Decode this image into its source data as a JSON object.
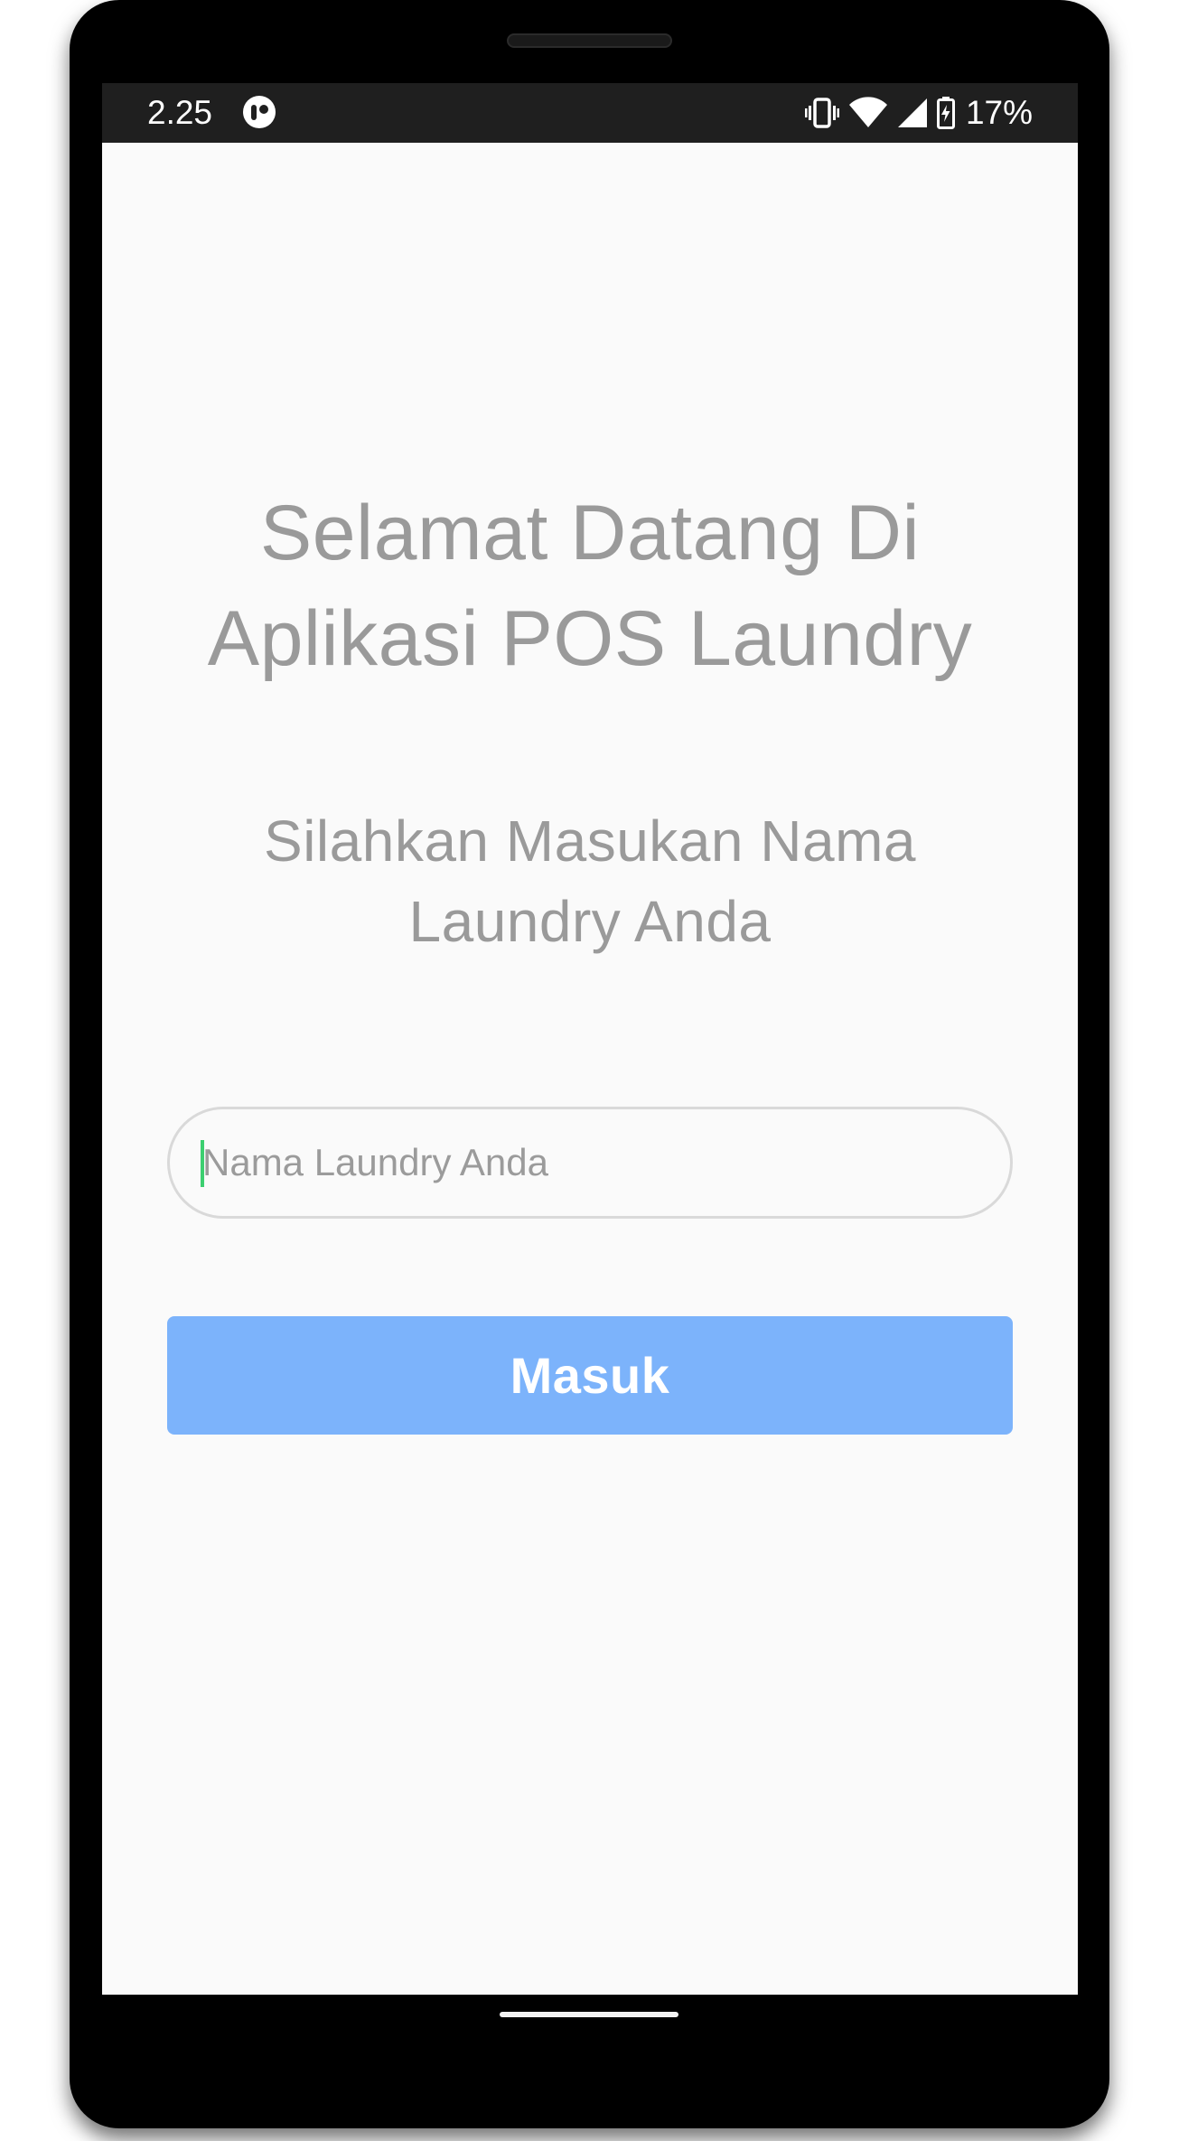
{
  "status_bar": {
    "time": "2.25",
    "app_icon": "notification-app-icon",
    "icons": [
      "vibrate-icon",
      "wifi-icon",
      "signal-icon",
      "battery-charging-icon"
    ],
    "battery_percent": "17%"
  },
  "welcome": {
    "title_line1": "Selamat Datang Di",
    "title_line2": "Aplikasi POS Laundry",
    "subtitle_line1": "Silahkan Masukan Nama",
    "subtitle_line2": "Laundry Anda"
  },
  "form": {
    "name_placeholder": "Nama Laundry Anda",
    "name_value": "",
    "submit_label": "Masuk"
  },
  "colors": {
    "button": "#7cb3fb",
    "text_muted": "#9a9a9a",
    "caret": "#3ccf70",
    "status_bar": "#1f1f1f"
  }
}
